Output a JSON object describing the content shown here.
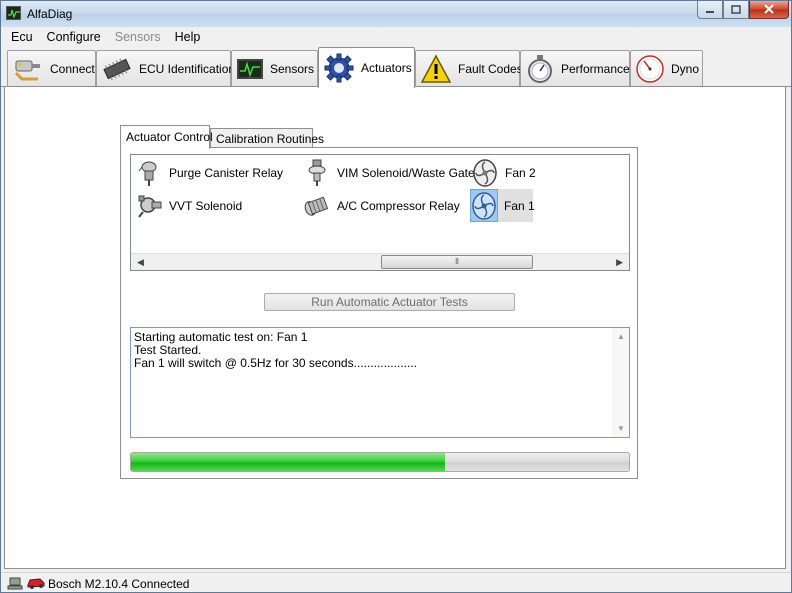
{
  "window": {
    "title": "AlfaDiag",
    "controls": {
      "minimize_icon": "minimize-icon",
      "maximize_icon": "maximize-icon",
      "close_icon": "close-icon"
    }
  },
  "menubar": {
    "items": [
      {
        "label": "Ecu",
        "enabled": true
      },
      {
        "label": "Configure",
        "enabled": true
      },
      {
        "label": "Sensors",
        "enabled": false
      },
      {
        "label": "Help",
        "enabled": true
      }
    ]
  },
  "toolbar": {
    "tabs": [
      {
        "label": "Connect",
        "icon": "connect-icon",
        "active": false
      },
      {
        "label": "ECU Identification",
        "icon": "chip-icon",
        "active": false
      },
      {
        "label": "Sensors",
        "icon": "oscilloscope-icon",
        "active": false
      },
      {
        "label": "Actuators",
        "icon": "gear-icon",
        "active": true
      },
      {
        "label": "Fault Codes",
        "icon": "warning-icon",
        "active": false
      },
      {
        "label": "Performance",
        "icon": "stopwatch-icon",
        "active": false
      },
      {
        "label": "Dyno",
        "icon": "dial-icon",
        "active": false
      }
    ]
  },
  "actuators_page": {
    "inner_tabs": [
      {
        "label": "Actuator Control",
        "active": true
      },
      {
        "label": "Calibration Routines",
        "active": false
      }
    ],
    "actuator_list": [
      {
        "name": "Purge Canister Relay",
        "icon": "relay-icon",
        "selected": false
      },
      {
        "name": "VIM Solenoid/Waste Gate",
        "icon": "solenoid-icon",
        "selected": false
      },
      {
        "name": "Fan 2",
        "icon": "fan-icon",
        "selected": false
      },
      {
        "name": "VVT Solenoid",
        "icon": "valve-icon",
        "selected": false
      },
      {
        "name": "A/C Compressor Relay",
        "icon": "compressor-icon",
        "selected": false
      },
      {
        "name": "Fan 1",
        "icon": "fan-icon",
        "selected": true
      }
    ],
    "run_button_label": "Run Automatic Actuator Tests",
    "log_lines": [
      "Starting automatic test on: Fan 1",
      "Test Started.",
      "Fan 1 will switch @ 0.5Hz for 30 seconds..................."
    ],
    "progress": 0.63
  },
  "statusbar": {
    "text": "Bosch M2.10.4 Connected",
    "icons": [
      "network-icon",
      "car-icon"
    ]
  },
  "colors": {
    "progress_fill": "#22c022",
    "selection": "#9fc8ef"
  }
}
